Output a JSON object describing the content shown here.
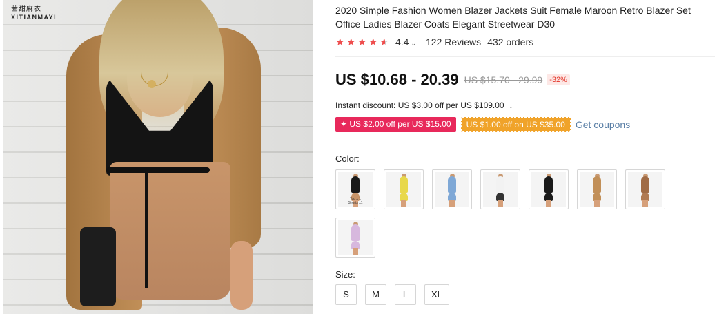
{
  "brand": {
    "cn": "茜甜麻衣",
    "en": "XITIANMAYI"
  },
  "product": {
    "title": "2020 Simple Fashion Women Blazer Jackets Suit Female Maroon Retro Blazer Set Office Ladies Blazer Coats Elegant Streetwear D30",
    "rating": {
      "stars": 4.4,
      "score_text": "4.4",
      "chevron": "⌄",
      "reviews": "122 Reviews",
      "orders": "432 orders"
    },
    "price": {
      "current": "US $10.68 - 20.39",
      "original": "US $15.70 - 29.99",
      "discount": "-32%"
    },
    "instant_discount": "Instant discount: US $3.00 off per US $109.00",
    "coupons": [
      {
        "text": "✦ US $2.00 off per US $15.00",
        "color": "#e8295b"
      },
      {
        "text": "US $1.00 off on US $35.00",
        "color": "#f0a32a"
      }
    ],
    "get_coupons": "Get coupons",
    "color_label": "Color:",
    "colors": [
      {
        "name": "camel-set",
        "top": "#1a1a1a",
        "bottom": "#c8956a",
        "caption": "Top x 1\nShorts x1"
      },
      {
        "name": "yellow",
        "top": "#e8d84a",
        "bottom": "#e8d84a",
        "caption": ""
      },
      {
        "name": "blue",
        "top": "#7fa8d6",
        "bottom": "#7fa8d6",
        "caption": ""
      },
      {
        "name": "white",
        "top": "#f2f2f2",
        "bottom": "#333",
        "caption": ""
      },
      {
        "name": "black",
        "top": "#1a1a1a",
        "bottom": "#1a1a1a",
        "caption": ""
      },
      {
        "name": "camel",
        "top": "#c18f58",
        "bottom": "#c18f58",
        "caption": ""
      },
      {
        "name": "brown",
        "top": "#a06b45",
        "bottom": "#b07a52",
        "caption": ""
      },
      {
        "name": "lilac",
        "top": "#d7b8de",
        "bottom": "#d7b8de",
        "caption": ""
      }
    ],
    "size_label": "Size:",
    "sizes": [
      "S",
      "M",
      "L",
      "XL"
    ]
  }
}
